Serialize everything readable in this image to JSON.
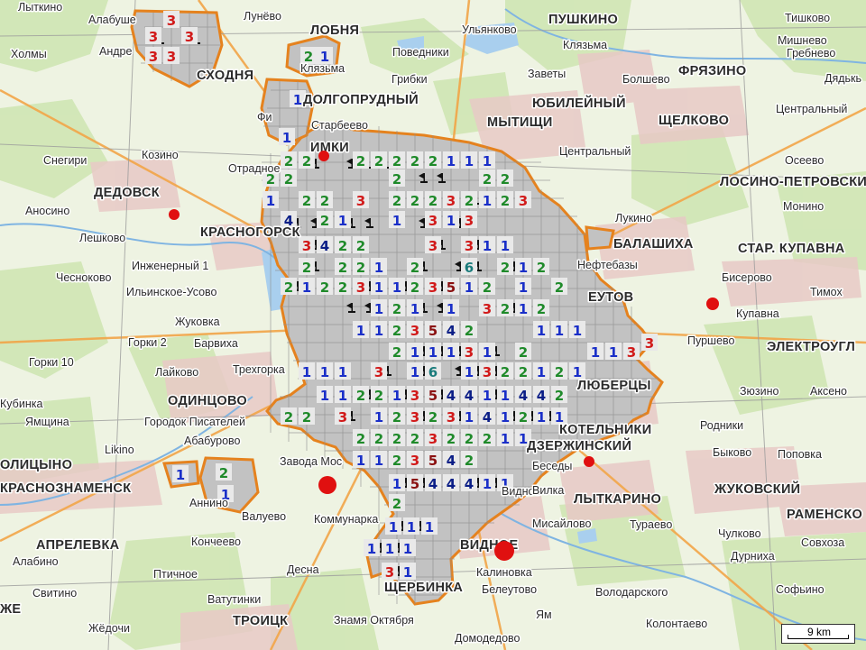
{
  "map": {
    "towns": [
      {
        "id": "lytkino",
        "label": "Лыткино"
      },
      {
        "id": "alabushevo",
        "label": "Алабуше"
      },
      {
        "id": "andreevka",
        "label": "Андре"
      },
      {
        "id": "kholmy",
        "label": "Холмы"
      },
      {
        "id": "lunevo",
        "label": "Лунёво"
      },
      {
        "id": "klyazma1",
        "label": "Клязьма"
      },
      {
        "id": "ulyankovo",
        "label": "Ульянково"
      },
      {
        "id": "povedniki",
        "label": "Поведники"
      },
      {
        "id": "klyazma2",
        "label": "Клязьма"
      },
      {
        "id": "tishkovo",
        "label": "Тишково"
      },
      {
        "id": "mishenovo",
        "label": "Мишнево"
      },
      {
        "id": "grebnevo",
        "label": "Гребнево"
      },
      {
        "id": "dyadkino",
        "label": "Дядькь"
      },
      {
        "id": "gribki",
        "label": "Грибки"
      },
      {
        "id": "zavety",
        "label": "Заветы"
      },
      {
        "id": "bolshevo",
        "label": "Болшево"
      },
      {
        "id": "tsentralny1",
        "label": "Центральный"
      },
      {
        "id": "starbeevo",
        "label": "Старбеево"
      },
      {
        "id": "firsanovka",
        "label": "Фи"
      },
      {
        "id": "kozino",
        "label": "Козино"
      },
      {
        "id": "snegiri",
        "label": "Снегири"
      },
      {
        "id": "otradnoe",
        "label": "Отрадное"
      },
      {
        "id": "tsentralny2",
        "label": "Центральный"
      },
      {
        "id": "oseevo",
        "label": "Осеево"
      },
      {
        "id": "anosino",
        "label": "Аносино"
      },
      {
        "id": "leshkovo",
        "label": "Лешково"
      },
      {
        "id": "lukino",
        "label": "Лукино"
      },
      {
        "id": "monino",
        "label": "Монино"
      },
      {
        "id": "chesnokovo",
        "label": "Чесноково"
      },
      {
        "id": "inzhenerny",
        "label": "Инженерный 1"
      },
      {
        "id": "ilinskoe",
        "label": "Ильинское-Усово"
      },
      {
        "id": "neftebazy",
        "label": "Нефтебазы"
      },
      {
        "id": "biserovo",
        "label": "Бисерово"
      },
      {
        "id": "timokhovo",
        "label": "Тимох"
      },
      {
        "id": "zhukovka",
        "label": "Жуковка"
      },
      {
        "id": "kupavna",
        "label": "Купавна"
      },
      {
        "id": "gorki2",
        "label": "Горки 2"
      },
      {
        "id": "barvikha",
        "label": "Барвиха"
      },
      {
        "id": "purshevo",
        "label": "Пуршево"
      },
      {
        "id": "gorki10",
        "label": "Горки 10"
      },
      {
        "id": "laykovo",
        "label": "Лайково"
      },
      {
        "id": "trekhgorka",
        "label": "Трехгорка"
      },
      {
        "id": "zyuzino",
        "label": "Зюзино"
      },
      {
        "id": "aksenovo",
        "label": "Аксено"
      },
      {
        "id": "kubinka",
        "label": "Кубинка"
      },
      {
        "id": "yamshchina",
        "label": "Ямщина"
      },
      {
        "id": "gorodok",
        "label": "Городок Писателей"
      },
      {
        "id": "rodniki",
        "label": "Родники"
      },
      {
        "id": "ababurovo",
        "label": "Абабурово"
      },
      {
        "id": "likino",
        "label": "Likino"
      },
      {
        "id": "bykovo",
        "label": "Быково"
      },
      {
        "id": "popovka",
        "label": "Поповка"
      },
      {
        "id": "zavod",
        "label": "Завода Мос"
      },
      {
        "id": "besedy",
        "label": "Беседы"
      },
      {
        "id": "annino",
        "label": "Аннино"
      },
      {
        "id": "valuevo",
        "label": "Валуево"
      },
      {
        "id": "kommunarka",
        "label": "Коммунарка"
      },
      {
        "id": "vidnoe_sub",
        "label": "Видное"
      },
      {
        "id": "misailovo",
        "label": "Мисайлово"
      },
      {
        "id": "turaevo",
        "label": "Тураево"
      },
      {
        "id": "koncheevo",
        "label": "Кончеево"
      },
      {
        "id": "chulkovo",
        "label": "Чулково"
      },
      {
        "id": "alabino",
        "label": "Алабино"
      },
      {
        "id": "ptichnoe",
        "label": "Птичное"
      },
      {
        "id": "desna",
        "label": "Десна"
      },
      {
        "id": "kalinovka",
        "label": "Калиновка"
      },
      {
        "id": "sovkhoz",
        "label": "Совхоза"
      },
      {
        "id": "durniha",
        "label": "Дурниха"
      },
      {
        "id": "svitino",
        "label": "Свитино"
      },
      {
        "id": "vatutinki",
        "label": "Ватутинки"
      },
      {
        "id": "beleutovo",
        "label": "Белеутово"
      },
      {
        "id": "volodarskogo",
        "label": "Володарского"
      },
      {
        "id": "sofino",
        "label": "Софьино"
      },
      {
        "id": "zhedochi",
        "label": "Жёдочи"
      },
      {
        "id": "yam",
        "label": "Ям"
      },
      {
        "id": "kolontaevo",
        "label": "Колонтаево"
      },
      {
        "id": "znamya",
        "label": "Знамя Октября"
      },
      {
        "id": "domodedovo_s",
        "label": "Домодедово"
      },
      {
        "id": "vilka",
        "label": "Вилка"
      }
    ],
    "cities": [
      {
        "id": "lobnya",
        "label": "ЛОБНЯ"
      },
      {
        "id": "pushkino",
        "label": "ПУШКИНО"
      },
      {
        "id": "skhodnya",
        "label": "СХОДНЯ"
      },
      {
        "id": "fryazino",
        "label": "ФРЯЗИНО"
      },
      {
        "id": "dolgoprudny",
        "label": "ДОЛГОПРУДНЫЙ"
      },
      {
        "id": "yubileyny",
        "label": "ЮБИЛЕЙНЫЙ"
      },
      {
        "id": "mytishchi",
        "label": "МЫТИЩИ"
      },
      {
        "id": "shchelkovo",
        "label": "ЩЕЛКОВО"
      },
      {
        "id": "khimki",
        "label": "ИМКИ"
      },
      {
        "id": "dedovsk",
        "label": "ДЕДОВСК"
      },
      {
        "id": "losino",
        "label": "ЛОСИНО-ПЕТРОВСКИ"
      },
      {
        "id": "krasnogorsk",
        "label": "КРАСНОГОРСК"
      },
      {
        "id": "balashikha",
        "label": "БАЛАШИХА"
      },
      {
        "id": "star_kupavna",
        "label": "СТАР. КУПАВНА"
      },
      {
        "id": "reutov",
        "label": "ЕУТОВ"
      },
      {
        "id": "elektrougli",
        "label": "ЭЛЕКТРОУГЛ"
      },
      {
        "id": "lyubertsy",
        "label": "ЛЮБЕРЦЫ"
      },
      {
        "id": "odintsovo",
        "label": "ОДИНЦОВО"
      },
      {
        "id": "kotelniki",
        "label": "КОТЕЛЬНИКИ"
      },
      {
        "id": "dzerzhinsky",
        "label": "ДЗЕРЖИНСКИЙ"
      },
      {
        "id": "golitsyno",
        "label": "ОЛИЦЫНО"
      },
      {
        "id": "krasnoznamensk",
        "label": "КРАСНОЗНАМЕНСК"
      },
      {
        "id": "lytkarino",
        "label": "ЛЫТКАРИНО"
      },
      {
        "id": "zhukovsky",
        "label": "ЖУКОВСКИЙ"
      },
      {
        "id": "ramenskoe",
        "label": "РАМЕНСКО"
      },
      {
        "id": "aprelevka",
        "label": "АПРЕЛЕВКА"
      },
      {
        "id": "vidnoe",
        "label": "ВИДНОЕ"
      },
      {
        "id": "shcherbinka",
        "label": "ЩЕРБИНКА"
      },
      {
        "id": "troitsk",
        "label": "ТРОИЦК"
      },
      {
        "id": "zhe",
        "label": "ЖЕ"
      }
    ],
    "scale": {
      "label": "9 km"
    },
    "colors": {
      "one": "#1a2fc8",
      "two": "#1f8a2a",
      "three": "#d11a1a",
      "four": "#0b1e86",
      "five": "#8a1010",
      "six": "#1a7b7b",
      "boundary": "#e5821e",
      "marker": "#e01010"
    }
  }
}
